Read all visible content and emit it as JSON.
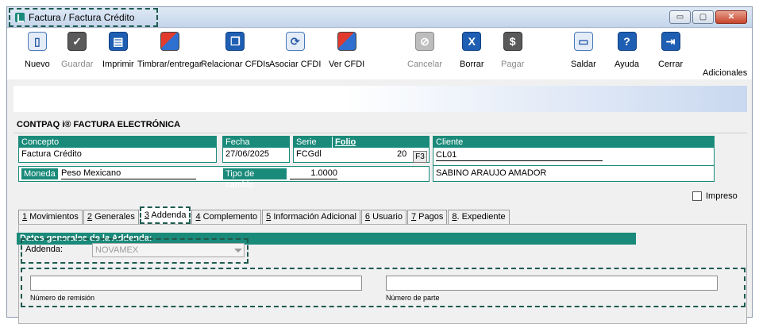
{
  "window": {
    "title": "Factura / Factura Crédito",
    "buttons": {
      "minimize": "▭",
      "maximize": "▢",
      "close": "✕"
    }
  },
  "toolbar": {
    "items": [
      {
        "label": "Nuevo",
        "icon": "document-icon"
      },
      {
        "label": "Guardar",
        "icon": "check-icon"
      },
      {
        "label": "Imprimir",
        "icon": "printer-icon"
      },
      {
        "label": "Timbrar/entregar",
        "icon": "stamp-icon"
      },
      {
        "label": "Relacionar CFDIs",
        "icon": "copy-icon"
      },
      {
        "label": "Asociar CFDI",
        "icon": "link-icon"
      },
      {
        "label": "Ver CFDI",
        "icon": "view-icon"
      },
      {
        "label": "Cancelar",
        "icon": "cancel-icon"
      },
      {
        "label": "Borrar",
        "icon": "delete-icon"
      },
      {
        "label": "Pagar",
        "icon": "pay-icon"
      },
      {
        "label": "Saldar",
        "icon": "balance-icon"
      },
      {
        "label": "Ayuda",
        "icon": "help-icon"
      },
      {
        "label": "Cerrar",
        "icon": "exit-icon"
      }
    ],
    "adicionales": "Adicionales"
  },
  "form": {
    "title": "CONTPAQ i® FACTURA ELECTRÓNICA",
    "concepto": {
      "label": "Concepto",
      "value": "Factura Crédito"
    },
    "fecha": {
      "label": "Fecha",
      "value": "27/06/2025"
    },
    "serie": {
      "label": "Serie",
      "value": "FCGdl"
    },
    "folio": {
      "label": "Folio",
      "value": "20",
      "button": "F3"
    },
    "cliente": {
      "label": "Cliente",
      "code": "CL01",
      "name": "SABINO ARAUJO AMADOR"
    },
    "moneda": {
      "label": "Moneda",
      "value": "Peso Mexicano"
    },
    "tipo_cambio": {
      "label": "Tipo de cambio",
      "value": "1.0000"
    },
    "impreso": "Impreso"
  },
  "tabs": [
    {
      "num": "1",
      "label": " Movimientos"
    },
    {
      "num": "2",
      "label": " Generales"
    },
    {
      "num": "3",
      "label": " Addenda"
    },
    {
      "num": "4",
      "label": " Complemento"
    },
    {
      "num": "5",
      "label": " Información Adicional"
    },
    {
      "num": "6",
      "label": " Usuario"
    },
    {
      "num": "7",
      "label": " Pagos"
    },
    {
      "num": "8",
      "label": ". Expediente"
    }
  ],
  "addenda": {
    "header": "Datos generales de la Addenda:",
    "label": "Addenda:",
    "value": "NOVAMEX",
    "numero_remision": "Número de remisión",
    "numero_parte": "Número de parte"
  }
}
